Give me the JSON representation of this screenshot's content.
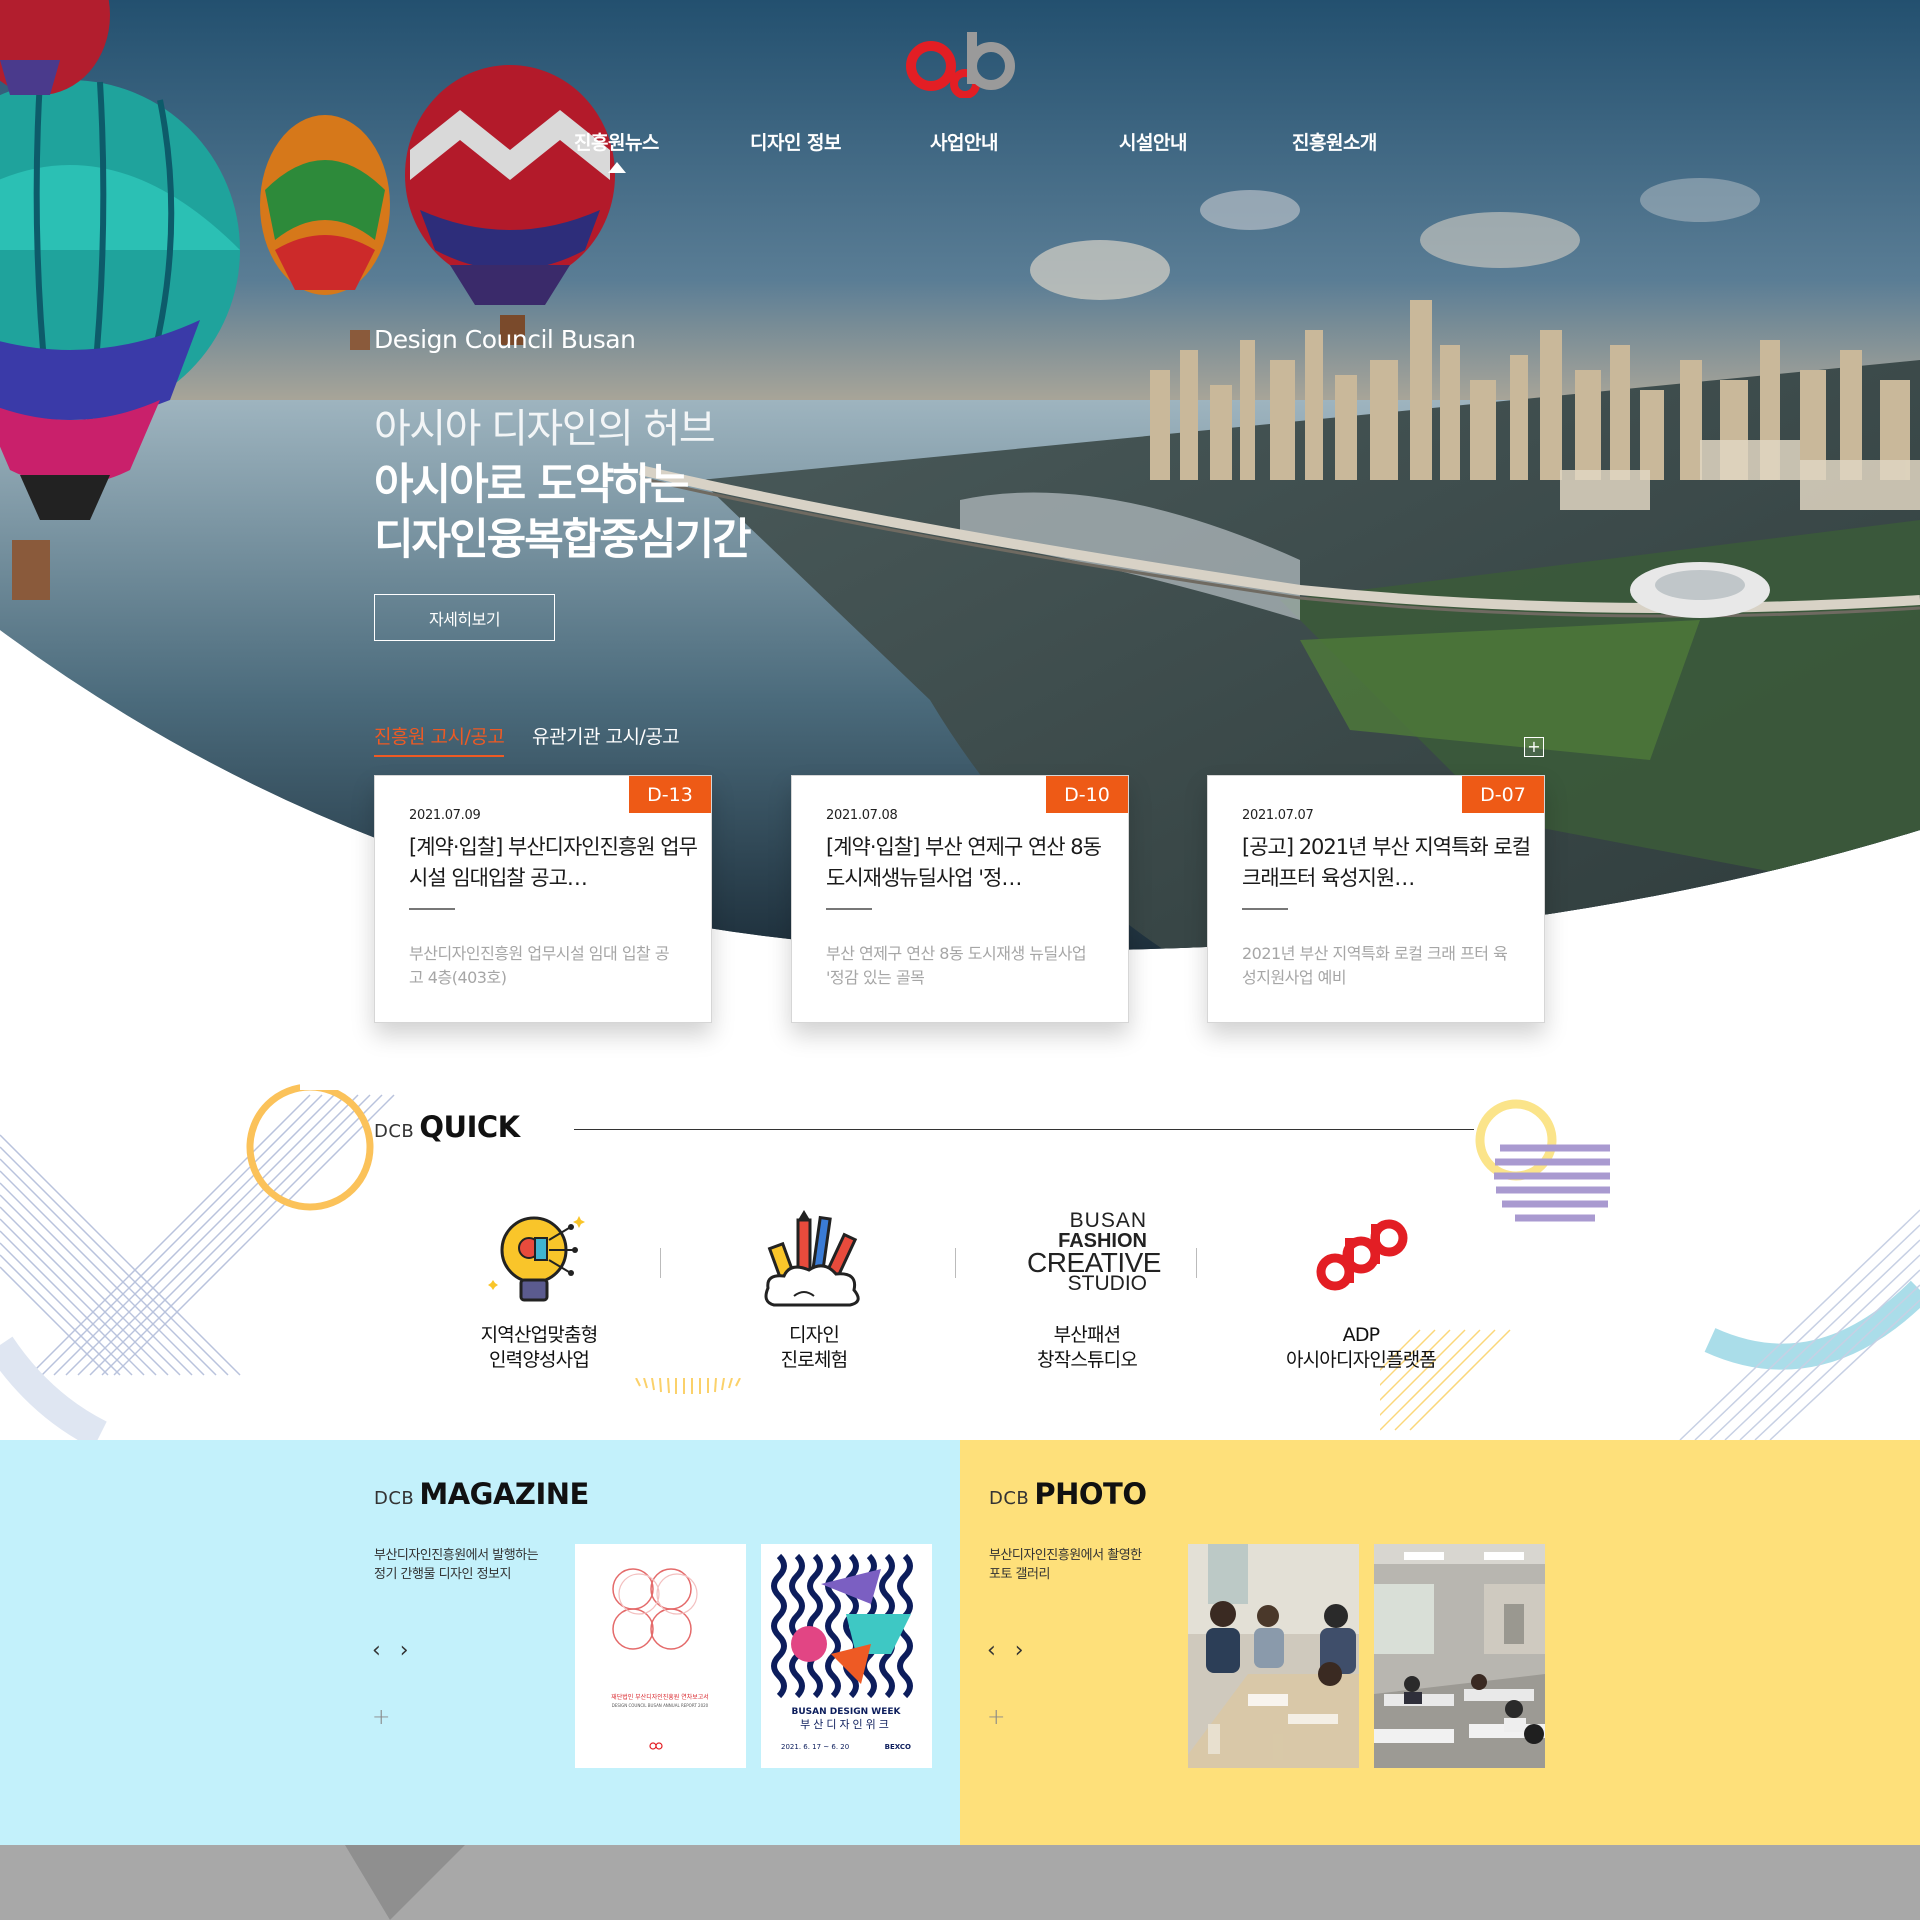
{
  "brand": {
    "logo_text": "dcb",
    "logo_color": "#e31e24",
    "logo_secondary": "#9a9a9a"
  },
  "nav": {
    "items": [
      {
        "label": "진흥원뉴스"
      },
      {
        "label": "디자인 정보"
      },
      {
        "label": "사업안내"
      },
      {
        "label": "시설안내"
      },
      {
        "label": "진흥원소개"
      }
    ],
    "active_index": 0
  },
  "hero": {
    "subtitle": "Design Council Busan",
    "line1": "아시아 디자인의 허브",
    "line2": "아시아로 도약하는",
    "line3": "디자인융복합중심기간",
    "button_label": "자세히보기"
  },
  "notice": {
    "tabs": [
      {
        "label": "진흥원 고시/공고",
        "active": true
      },
      {
        "label": "유관기관 고시/공고",
        "active": false
      }
    ],
    "more_label": "+",
    "accent_color": "#ee5a16",
    "cards": [
      {
        "badge": "D-13",
        "date": "2021.07.09",
        "title": "[계약·입찰] 부산디자인진흥원 업무시설 임대입찰 공고…",
        "desc": "부산디자인진흥원 업무시설 임대 입찰 공고 4층(403호)"
      },
      {
        "badge": "D-10",
        "date": "2021.07.08",
        "title": "[계약·입찰] 부산 연제구 연산 8동 도시재생뉴딜사업 '정…",
        "desc": "부산 연제구 연산 8동 도시재생 뉴딜사업 '정감 있는 골목"
      },
      {
        "badge": "D-07",
        "date": "2021.07.07",
        "title": "[공고] 2021년 부산 지역특화 로컬 크래프터 육성지원…",
        "desc": "2021년 부산 지역특화 로컬 크래 프터 육성지원사업 예비"
      }
    ]
  },
  "quick": {
    "prefix": "DCB",
    "title": "QUICK",
    "items": [
      {
        "icon": "lightbulb-icon",
        "label": "지역산업맞춤형\n인력양성사업"
      },
      {
        "icon": "art-tools-icon",
        "label": "디자인\n진로체험"
      },
      {
        "icon": "busan-fashion-logo",
        "label": "부산패션\n창작스튜디오",
        "logo_lines": [
          "BUSAN",
          "FASHION",
          "CREATIVE",
          "STUDIO"
        ]
      },
      {
        "icon": "adp-logo",
        "label": "ADP\n아시아디자인플랫폼"
      }
    ]
  },
  "magazine": {
    "prefix": "DCB",
    "title": "MAGAZINE",
    "desc": "부산디자인진흥원에서 발행하는\n정기 간행물 디자인 정보지",
    "arrows": "‹ ›",
    "plus": "+",
    "bg_color": "#c3f1fb",
    "covers": [
      {
        "big_text": "2020",
        "caption": "재단법인 부산디자인진흥원 연차보고서",
        "sub": "DESIGN COUNCIL BUSAN ANNUAL REPORT 2020"
      },
      {
        "big_text": "BUSAN",
        "caption": "BUSAN DESIGN WEEK",
        "sub": "부산디자인위크",
        "dates": "2021. 6. 17 ~ 6. 20",
        "venue": "BEXCO"
      }
    ]
  },
  "photo": {
    "prefix": "DCB",
    "title": "PHOTO",
    "desc": "부산디자인진흥원에서 촬영한\n포토 갤러리",
    "arrows": "‹ ›",
    "plus": "+",
    "bg_color": "#fee07a"
  }
}
